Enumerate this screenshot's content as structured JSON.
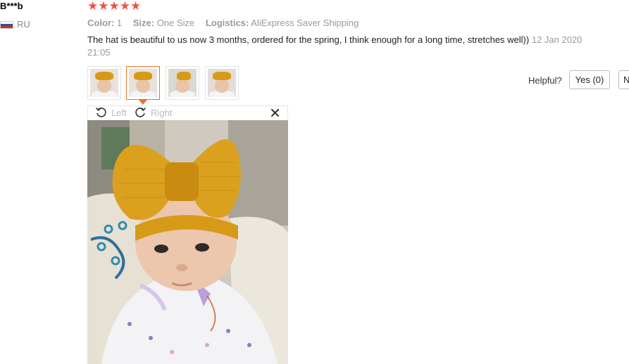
{
  "reviewer": {
    "name": "B***b",
    "country": "RU",
    "flag_colors": [
      "#ffffff",
      "#1c57a8",
      "#d52b1e"
    ]
  },
  "rating": {
    "stars": "★★★★★",
    "value": 5,
    "max": 5,
    "star_color": "#f05247"
  },
  "meta": {
    "color_label": "Color:",
    "color_value": "1",
    "size_label": "Size:",
    "size_value": "One Size",
    "logistics_label": "Logistics:",
    "logistics_value": "AliExpress Saver Shipping"
  },
  "review": {
    "text": "The hat is beautiful to us now 3 months, ordered for the spring, I think enough for a long time, stretches well))",
    "date": "12 Jan 2020 21:05"
  },
  "thumbnails": [
    {
      "name": "photo-1",
      "active": false
    },
    {
      "name": "photo-2",
      "active": true
    },
    {
      "name": "photo-3",
      "active": false
    },
    {
      "name": "photo-4",
      "active": false
    }
  ],
  "helpful": {
    "label": "Helpful?",
    "yes_label": "Yes (0)",
    "no_label": "N"
  },
  "viewer": {
    "rotate_left_label": "Left",
    "rotate_right_label": "Right",
    "rotate_left_icon": "rotate-left-icon",
    "rotate_right_icon": "rotate-right-icon",
    "close_icon": "close-icon"
  },
  "colors": {
    "accent_orange": "#e4762b",
    "bow_mustard": "#d69a17",
    "muted_text": "#999999"
  }
}
